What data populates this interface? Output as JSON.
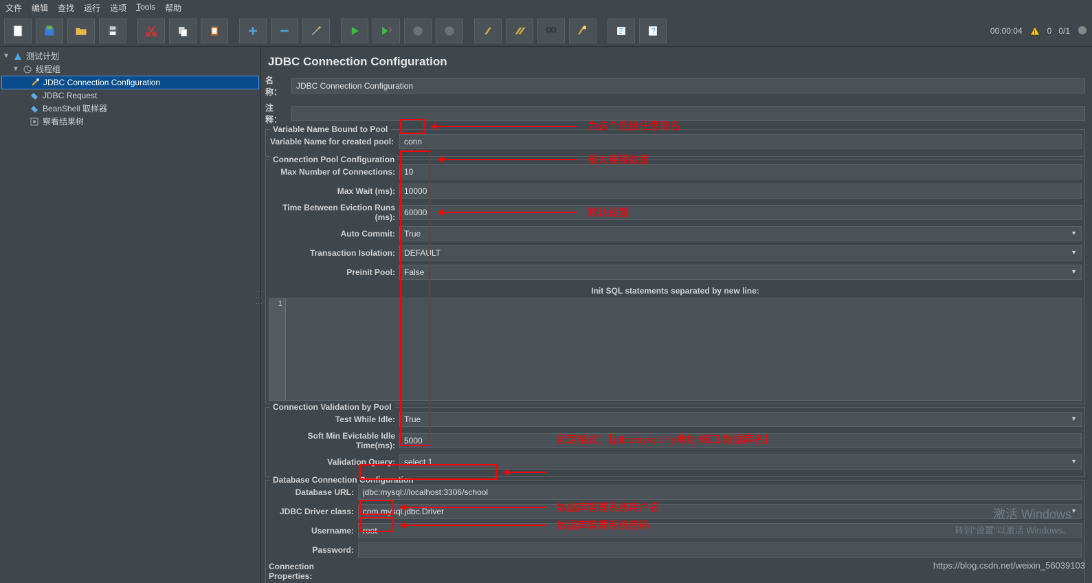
{
  "menu": {
    "file": "文件",
    "edit": "编辑",
    "find": "查找",
    "run": "运行",
    "options": "选项",
    "tools": "Tools",
    "help": "帮助"
  },
  "status": {
    "time": "00:00:04",
    "count": "0",
    "total": "0/1"
  },
  "tree": {
    "root": "测试计划",
    "threadgroup": "线程组",
    "jdbc_conn": "JDBC Connection Configuration",
    "jdbc_req": "JDBC Request",
    "beanshell": "BeanShell 取样器",
    "result_tree": "察看结果树"
  },
  "panel": {
    "title": "JDBC Connection Configuration",
    "name_label": "名称：",
    "name_value": "JDBC Connection Configuration",
    "comment_label": "注释：",
    "sec_varname": "Variable Name Bound to Pool",
    "varname_label": "Variable Name for created pool:",
    "varname_value": "conn",
    "sec_pool": "Connection Pool Configuration",
    "maxconn_label": "Max Number of Connections:",
    "maxconn_value": "10",
    "maxwait_label": "Max Wait (ms):",
    "maxwait_value": "10000",
    "evict_label": "Time Between Eviction Runs (ms):",
    "evict_value": "60000",
    "autocommit_label": "Auto Commit:",
    "autocommit_value": "True",
    "txiso_label": "Transaction Isolation:",
    "txiso_value": "DEFAULT",
    "preinit_label": "Preinit Pool:",
    "preinit_value": "False",
    "initsql_label": "Init SQL statements separated by new line:",
    "line1": "1",
    "sec_valid": "Connection Validation by Pool",
    "testidle_label": "Test While Idle:",
    "testidle_value": "True",
    "softmin_label": "Soft Min Evictable Idle Time(ms):",
    "softmin_value": "5000",
    "vquery_label": "Validation Query:",
    "vquery_value": "select 1",
    "sec_db": "Database Connection Configuration",
    "dburl_label": "Database URL:",
    "dburl_value": "jdbc:mysql://localhost:3306/school",
    "driver_label": "JDBC Driver class:",
    "driver_value": "com.mysql.jdbc.Driver",
    "user_label": "Username:",
    "user_value": "root",
    "pass_label": "Password:",
    "pass_value": "",
    "connprops_label": "Connection Properties:"
  },
  "annotations": {
    "a1": "为这个连接任意取名",
    "a2": "最大连接数量",
    "a3": "默认设置",
    "a4": "固定格式：【jdbc:mysql://ip地址:端口/数据库名】",
    "a5": "数据库管理系统用户名",
    "a6": "数据库管理系统密码"
  },
  "watermark": {
    "l1": "激活 Windows",
    "l2": "转到\"设置\"以激活 Windows。",
    "blog": "https://blog.csdn.net/weixin_56039103"
  }
}
